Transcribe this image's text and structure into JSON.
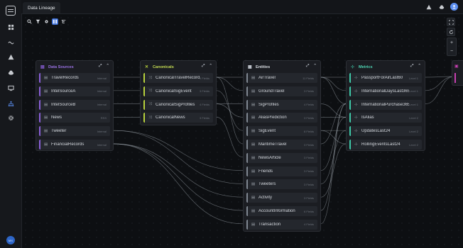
{
  "window": {
    "tab_title": "Data Lineage"
  },
  "sidebar": {
    "avatar_initials": "MX",
    "items": [
      {
        "icon": "grid-icon"
      },
      {
        "icon": "flow-icon"
      },
      {
        "icon": "warning-icon"
      },
      {
        "icon": "cloud-icon"
      },
      {
        "icon": "monitor-icon"
      },
      {
        "icon": "lineage-icon"
      },
      {
        "icon": "gear-icon"
      }
    ]
  },
  "colors": {
    "sources": "#8a5fd8",
    "canonicals": "#b8d23c",
    "entities": "#7f8791",
    "metrics": "#3ec9a8",
    "partial": "#c63fb0"
  },
  "nodes": {
    "sources": {
      "title": "Data Sources",
      "rows": [
        {
          "name": "TravelRecords",
          "badge": "Internal"
        },
        {
          "name": "IntelSourceA",
          "badge": "Internal"
        },
        {
          "name": "IntelSourceB",
          "badge": "Internal"
        },
        {
          "name": "News",
          "badge": "RSS"
        },
        {
          "name": "Tweeter",
          "badge": "Internal"
        },
        {
          "name": "FinancialRecords",
          "badge": "Internal"
        }
      ]
    },
    "canonicals": {
      "title": "Canonicals",
      "rows": [
        {
          "name": "CanonicalTravelRecords",
          "badge": "9 Fields"
        },
        {
          "name": "CanonicalSigEvent",
          "badge": "3 Fields"
        },
        {
          "name": "CanonicalSigProfiles",
          "badge": "4 Fields"
        },
        {
          "name": "CanonicalNews",
          "badge": "3 Fields"
        }
      ]
    },
    "entities": {
      "title": "Entities",
      "rows": [
        {
          "name": "AirTravel",
          "badge": "11 Fields"
        },
        {
          "name": "GroundTravel",
          "badge": "3 Fields"
        },
        {
          "name": "SigProfiles",
          "badge": "4 Fields"
        },
        {
          "name": "AliasPrediction",
          "badge": "3 Fields"
        },
        {
          "name": "SigEvent",
          "badge": "8 Fields"
        },
        {
          "name": "MaritimeTravel",
          "badge": "3 Fields"
        },
        {
          "name": "NewsArticle",
          "badge": "3 Fields"
        },
        {
          "name": "Friends",
          "badge": "3 Fields"
        },
        {
          "name": "Tweeters",
          "badge": "3 Fields"
        },
        {
          "name": "Activity",
          "badge": "3 Fields"
        },
        {
          "name": "AccountInformation",
          "badge": "6 Fields"
        },
        {
          "name": "Transaction",
          "badge": "4 Fields"
        }
      ]
    },
    "metrics": {
      "title": "Metrics",
      "rows": [
        {
          "name": "PassportForAirLast60",
          "badge": "Level 1"
        },
        {
          "name": "InternationalDaysLast365",
          "badge": "Level 1"
        },
        {
          "name": "InternationalPurchase365",
          "badge": "Level 1"
        },
        {
          "name": "IsAlias",
          "badge": "Level 2"
        },
        {
          "name": "UpdatesLast24",
          "badge": "Level 2"
        },
        {
          "name": "RollingEventsLast24",
          "badge": "Level 2"
        }
      ]
    }
  }
}
